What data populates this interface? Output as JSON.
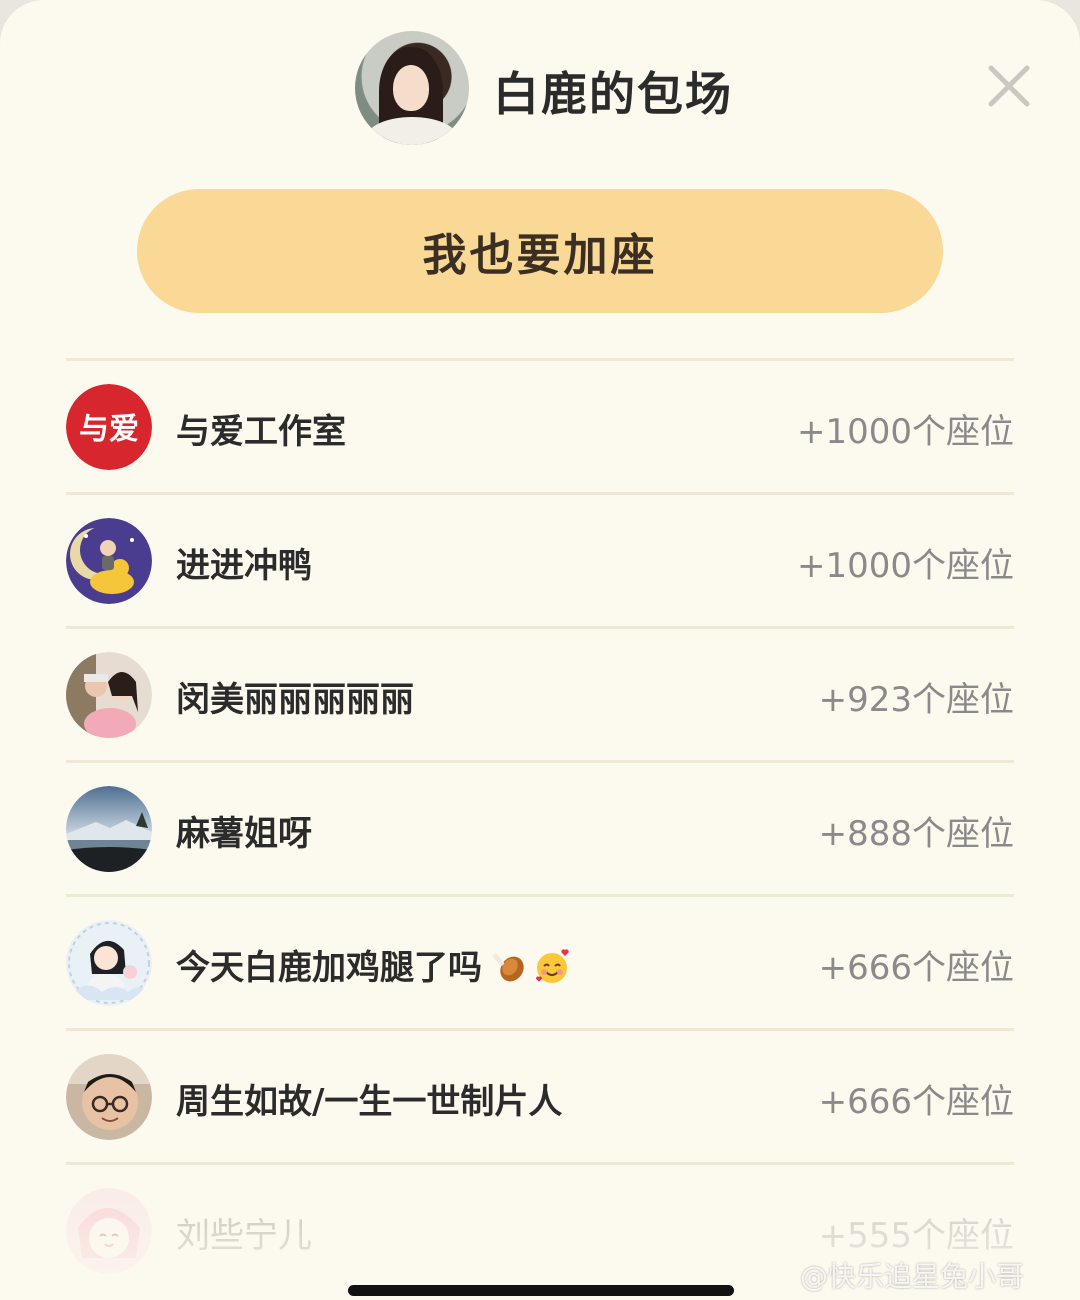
{
  "header": {
    "title": "白鹿的包场",
    "close_icon": "close-icon"
  },
  "action": {
    "add_seat_label": "我也要加座"
  },
  "supporters": [
    {
      "name": "与爱工作室",
      "seats": "+1000个座位",
      "avatar": "studio-logo",
      "logo_text": "与爱"
    },
    {
      "name": "进进冲鸭",
      "seats": "+1000个座位",
      "avatar": "duck-moon"
    },
    {
      "name": "闵美丽丽丽丽丽",
      "seats": "+923个座位",
      "avatar": "couple-photo"
    },
    {
      "name": "麻薯姐呀",
      "seats": "+888个座位",
      "avatar": "landscape"
    },
    {
      "name": "今天白鹿加鸡腿了吗",
      "seats": "+666个座位",
      "avatar": "cartoon-girl",
      "emojis": [
        "poultry-leg-icon",
        "smiling-hearts-icon"
      ]
    },
    {
      "name": "周生如故/一生一世制片人",
      "seats": "+666个座位",
      "avatar": "man-glasses"
    },
    {
      "name": "刘些宁儿",
      "seats": "+555个座位",
      "avatar": "pink-cartoon"
    }
  ],
  "watermark": "@快乐追星兔小哥",
  "colors": {
    "background": "#fcf9ef",
    "button": "#fad895",
    "divider": "#efe8d6",
    "studio_red": "#d8262e"
  }
}
